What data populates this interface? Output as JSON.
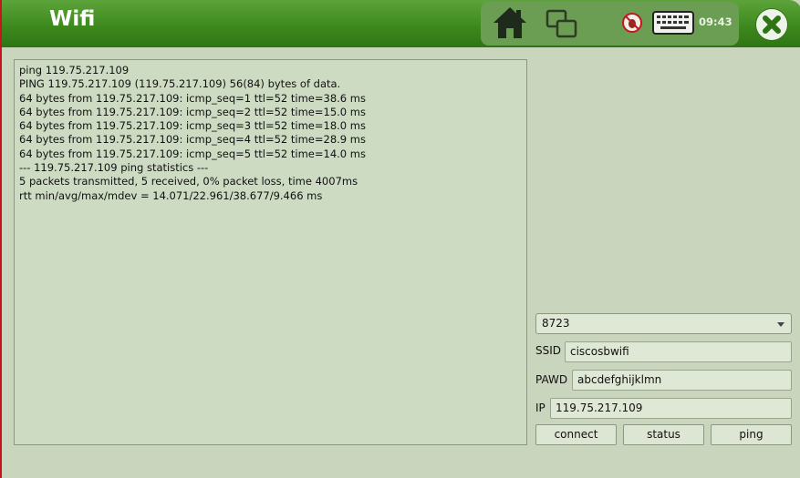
{
  "app": {
    "title": "Wifi"
  },
  "toolbar": {
    "time": "09:43"
  },
  "terminal": {
    "lines": [
      "ping 119.75.217.109",
      "PING 119.75.217.109 (119.75.217.109) 56(84) bytes of data.",
      "64 bytes from 119.75.217.109: icmp_seq=1 ttl=52 time=38.6 ms",
      "64 bytes from 119.75.217.109: icmp_seq=2 ttl=52 time=15.0 ms",
      "64 bytes from 119.75.217.109: icmp_seq=3 ttl=52 time=18.0 ms",
      "64 bytes from 119.75.217.109: icmp_seq=4 ttl=52 time=28.9 ms",
      "64 bytes from 119.75.217.109: icmp_seq=5 ttl=52 time=14.0 ms",
      "--- 119.75.217.109 ping statistics ---",
      "5 packets transmitted, 5 received, 0% packet loss, time 4007ms",
      "rtt min/avg/max/mdev = 14.071/22.961/38.677/9.466 ms"
    ]
  },
  "form": {
    "network_select": "8723",
    "ssid_label": "SSID",
    "ssid_value": "ciscosbwifi",
    "pawd_label": "PAWD",
    "pawd_value": "abcdefghijklmn",
    "ip_label": "IP",
    "ip_value": "119.75.217.109"
  },
  "buttons": {
    "connect": "connect",
    "status": "status",
    "ping": "ping"
  },
  "icons": [
    "home-icon",
    "windows-icon",
    "bug-icon",
    "keyboard-icon",
    "close-icon"
  ],
  "colors": {
    "titlebar": "#3e8a1e",
    "background": "#cad5bd",
    "close": "#2f7414"
  }
}
